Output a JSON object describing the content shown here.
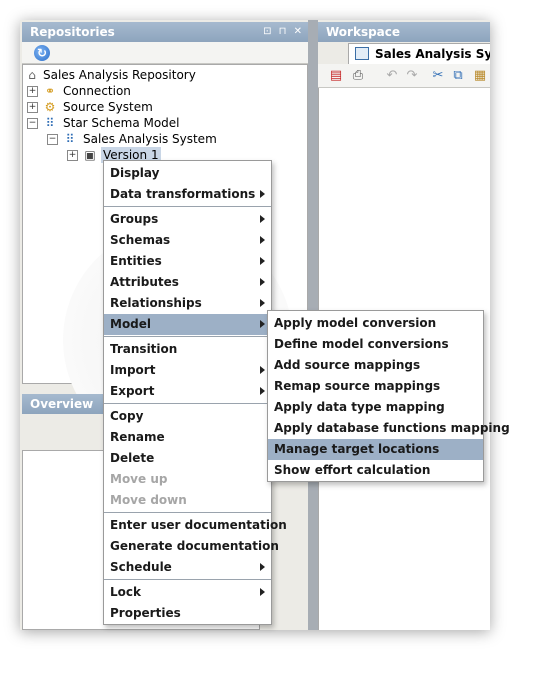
{
  "repositories": {
    "title": "Repositories",
    "header_buttons": "⊡ ⊓ ✕",
    "refresh_icon": "↻",
    "tree": [
      {
        "label": "Sales Analysis Repository",
        "icon": "repository-icon"
      },
      {
        "label": "Connection",
        "icon": "connection-icon"
      },
      {
        "label": "Source System",
        "icon": "source-system-icon"
      },
      {
        "label": "Star Schema Model",
        "icon": "star-schema-icon"
      },
      {
        "label": "Sales Analysis System",
        "icon": "system-icon"
      },
      {
        "label": "Version 1",
        "icon": "version-icon"
      }
    ]
  },
  "workspace": {
    "title": "Workspace",
    "tab_label": "Sales Analysis Syste"
  },
  "overview": {
    "title": "Overview"
  },
  "context_menu": {
    "items": [
      {
        "label": "Display"
      },
      {
        "label": "Data transformations"
      },
      {
        "label": "Groups"
      },
      {
        "label": "Schemas"
      },
      {
        "label": "Entities"
      },
      {
        "label": "Attributes"
      },
      {
        "label": "Relationships"
      },
      {
        "label": "Model"
      },
      {
        "label": "Transition"
      },
      {
        "label": "Import"
      },
      {
        "label": "Export"
      },
      {
        "label": "Copy"
      },
      {
        "label": "Rename"
      },
      {
        "label": "Delete"
      },
      {
        "label": "Move up"
      },
      {
        "label": "Move down"
      },
      {
        "label": "Enter user documentation"
      },
      {
        "label": "Generate documentation"
      },
      {
        "label": "Schedule"
      },
      {
        "label": "Lock"
      },
      {
        "label": "Properties"
      }
    ]
  },
  "model_submenu": {
    "items": [
      {
        "label": "Apply model conversion"
      },
      {
        "label": "Define model conversions"
      },
      {
        "label": "Add source mappings"
      },
      {
        "label": "Remap source mappings"
      },
      {
        "label": "Apply data type mapping"
      },
      {
        "label": "Apply database functions mapping"
      },
      {
        "label": "Manage target locations"
      },
      {
        "label": "Show effort calculation"
      }
    ]
  },
  "colors": {
    "panel_header": "#8da4bd",
    "menu_highlight": "#9db0c6",
    "disabled_text": "#a6a6a6"
  }
}
